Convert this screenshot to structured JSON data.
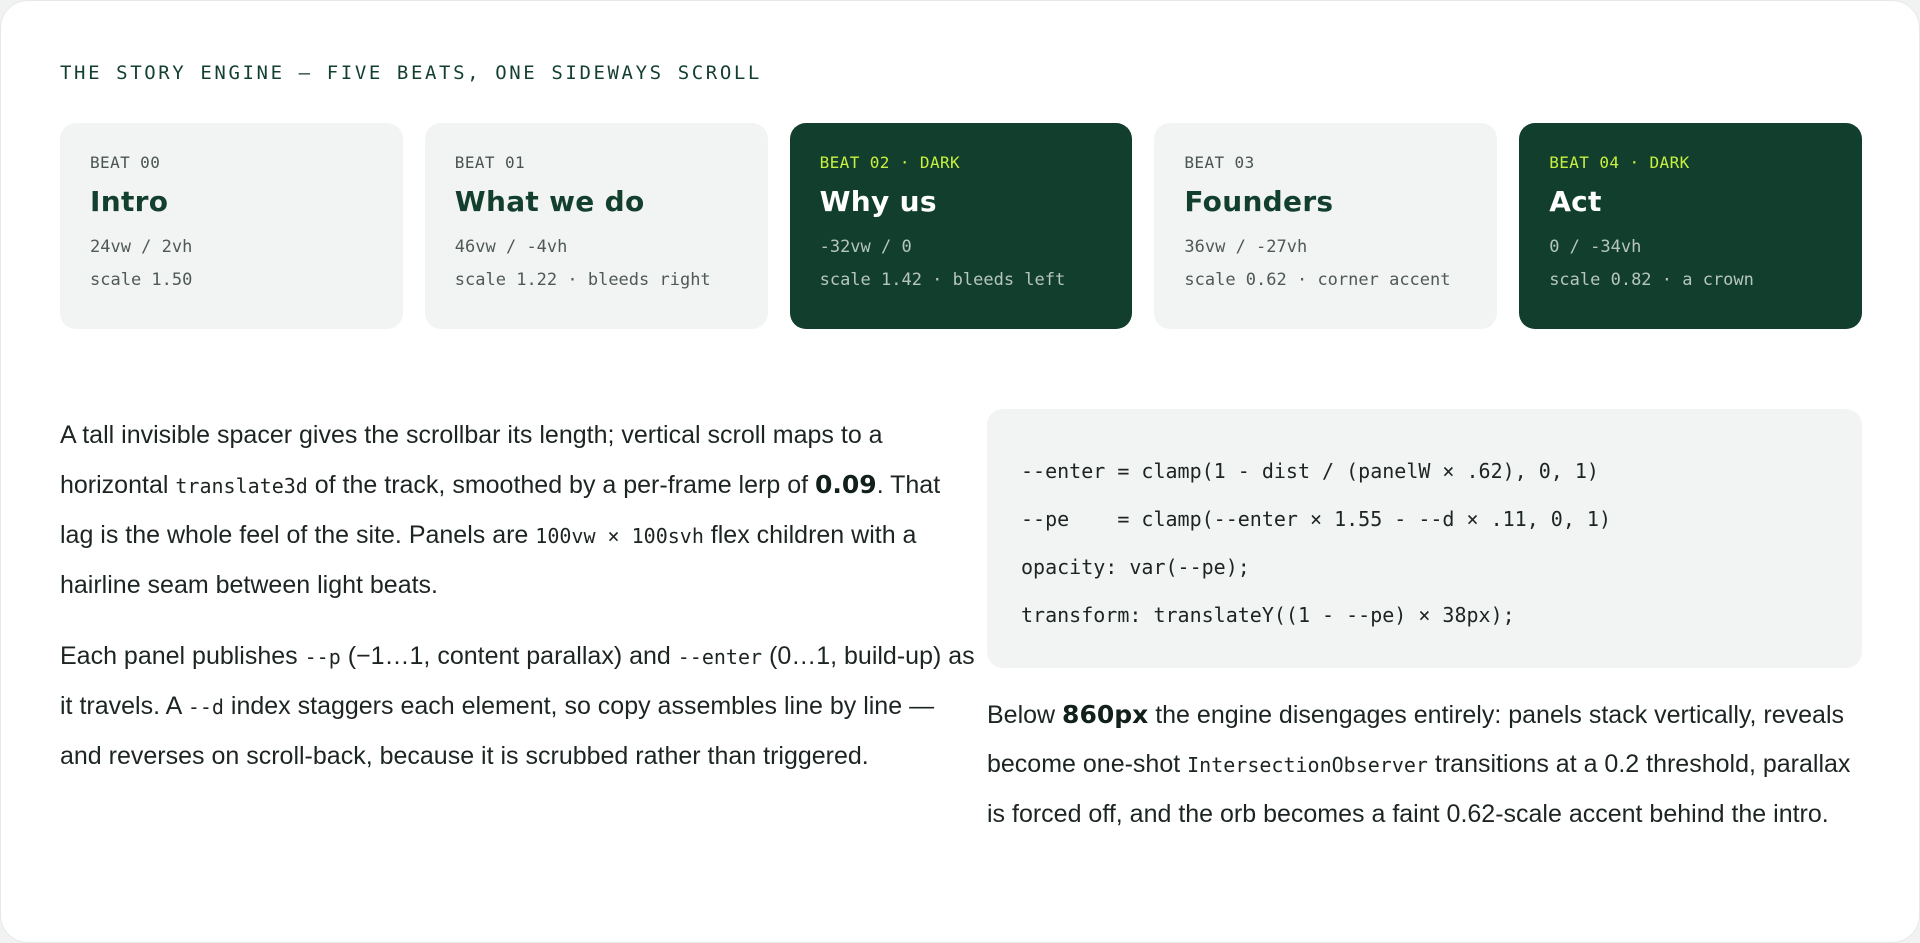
{
  "kicker": "THE STORY ENGINE — FIVE BEATS, ONE SIDEWAYS SCROLL",
  "beats": [
    {
      "label": "BEAT 00",
      "title": "Intro",
      "line1": "24vw / 2vh",
      "line2": "scale 1.50",
      "dark": false
    },
    {
      "label": "BEAT 01",
      "title": "What we do",
      "line1": "46vw / -4vh",
      "line2": "scale 1.22 · bleeds right",
      "dark": false
    },
    {
      "label": "BEAT 02 · DARK",
      "title": "Why us",
      "line1": "-32vw / 0",
      "line2": "scale 1.42 · bleeds left",
      "dark": true
    },
    {
      "label": "BEAT 03",
      "title": "Founders",
      "line1": "36vw / -27vh",
      "line2": "scale 0.62 · corner accent",
      "dark": false
    },
    {
      "label": "BEAT 04 · DARK",
      "title": "Act",
      "line1": "0 / -34vh",
      "line2": "scale 0.82 · a crown",
      "dark": true
    }
  ],
  "left": {
    "p1": {
      "a": "A tall invisible spacer gives the scrollbar its length; vertical scroll maps to a horizontal ",
      "code1": "translate3d",
      "b": " of the track, smoothed by a per-frame lerp of ",
      "strong": "0.09",
      "c": ". That lag is the whole feel of the site. Panels are ",
      "code2": "100vw × 100svh",
      "d": " flex children with a hairline seam between light beats."
    },
    "p2": {
      "a": "Each panel publishes ",
      "code1": "--p",
      "b": " (−1…1, content parallax) and ",
      "code2": "--enter",
      "c": " (0…1, build-up) as it travels. A ",
      "code3": "--d",
      "d": " index staggers each element, so copy assembles line by line — and reverses on scroll-back, because it is scrubbed rather than triggered."
    }
  },
  "code_lines": [
    "--enter = clamp(1 - dist / (panelW × .62), 0, 1)",
    "--pe    = clamp(--enter × 1.55 - --d × .11, 0, 1)",
    "opacity: var(--pe);",
    "transform: translateY((1 - --pe) × 38px);"
  ],
  "right": {
    "a": "Below ",
    "strong": "860px",
    "b": " the engine disengages entirely: panels stack vertically, reveals become one-shot ",
    "code1": "IntersectionObserver",
    "c": " transitions at a 0.2 threshold, parallax is forced off, and the orb becomes a faint 0.62-scale accent behind the intro."
  }
}
